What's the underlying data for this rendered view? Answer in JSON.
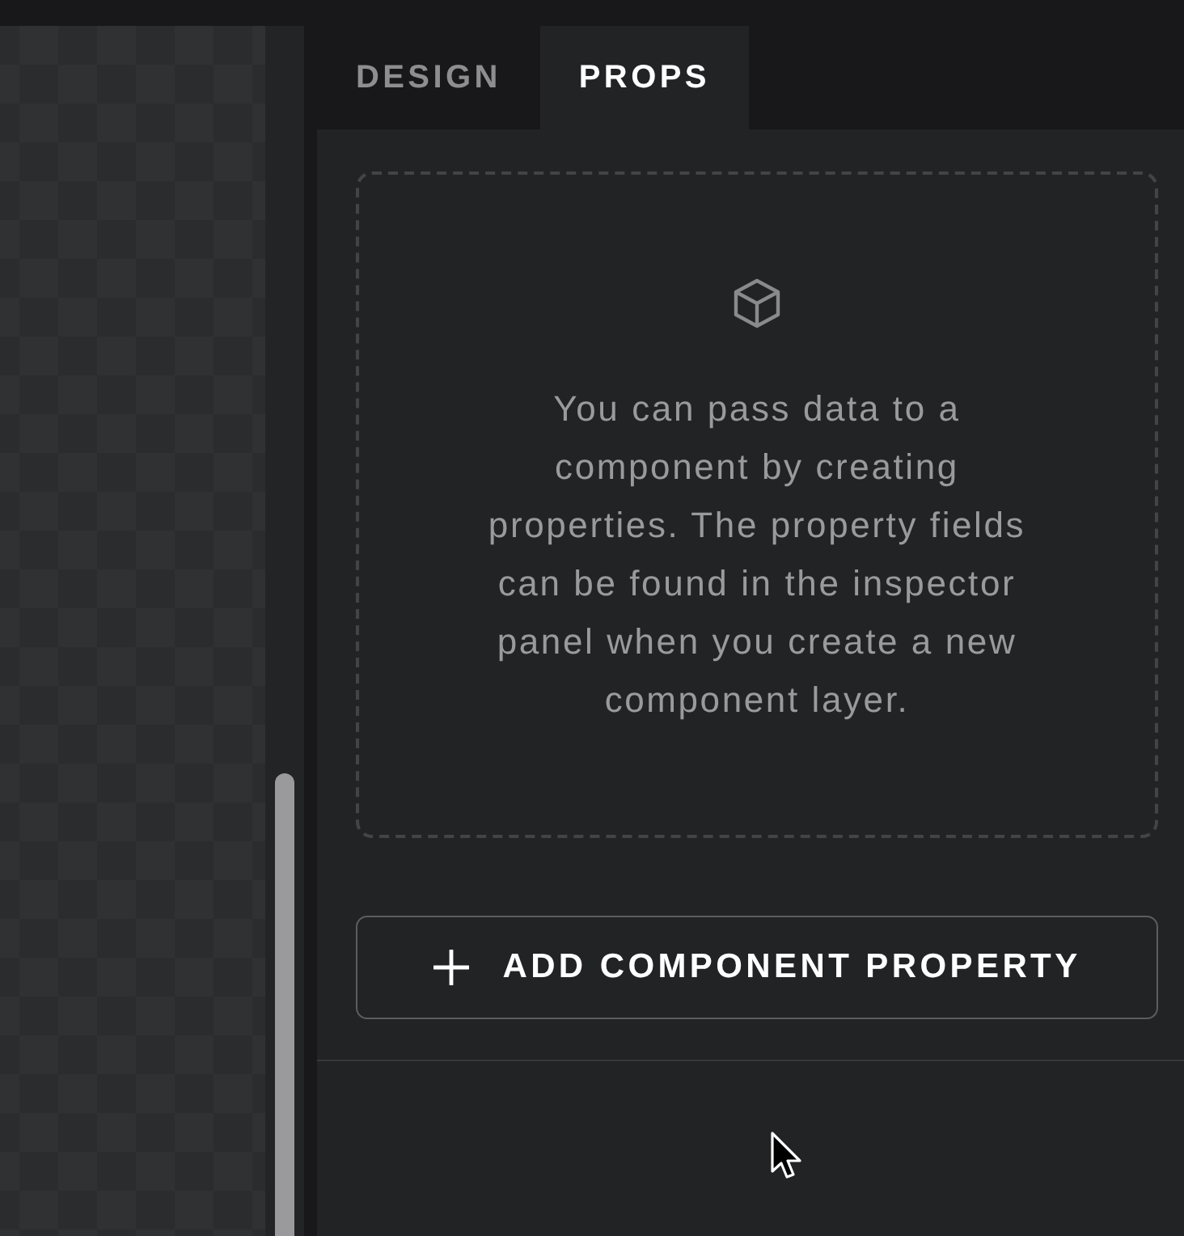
{
  "tabs": [
    {
      "label": "DESIGN",
      "selected": false
    },
    {
      "label": "PROPS",
      "selected": true
    }
  ],
  "empty_state": {
    "message": "You can pass data to a component by creating properties. The property fields can be found in the inspector panel when you create a new component layer."
  },
  "add_button": {
    "label": "ADD COMPONENT PROPERTY"
  }
}
